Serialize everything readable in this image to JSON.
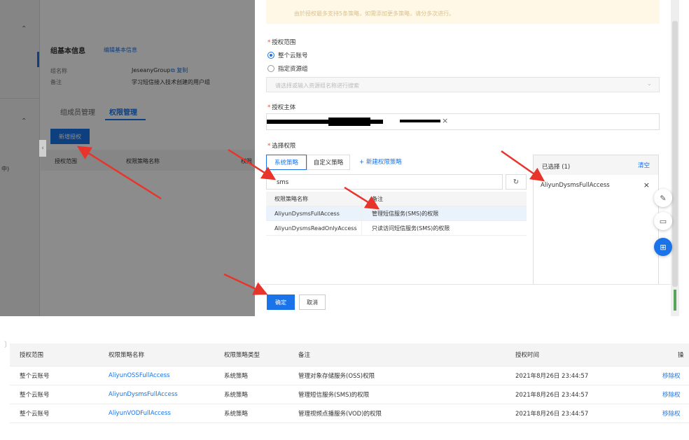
{
  "background": {
    "group_basic_info_title": "组基本信息",
    "edit_basic_info": "编辑基本信息",
    "group_name_label": "组名称",
    "group_name_value": "JeseanyGroup",
    "copy_label": "复制",
    "remark_label": "备注",
    "remark_value": "学习短信接入技术创建的用户组",
    "tabs": [
      "组成员管理",
      "权限管理"
    ],
    "add_grant_button": "新增授权",
    "col_scope": "授权范围",
    "col_policy_name": "权限策略名称",
    "col_partial": "权限",
    "side_partial_text": "中)"
  },
  "drawer": {
    "warning_text": "由於授权最多支持5条策略，如需添加更多策略，请分多次进行。",
    "scope_label": "授权范围",
    "scope_options": [
      {
        "label": "整个云账号",
        "checked": true
      },
      {
        "label": "指定资源组",
        "checked": false
      }
    ],
    "resource_group_placeholder": "请选择或输入资源组名称进行搜索",
    "principal_label": "授权主体",
    "select_permission_label": "选择权限",
    "policy_tabs": [
      "系统策略",
      "自定义策略"
    ],
    "new_policy_link": "+ 新建权限策略",
    "search_value": "sms",
    "policy_table": {
      "headers": [
        "权限策略名称",
        "备注"
      ],
      "rows": [
        {
          "name": "AliyunDysmsFullAccess",
          "remark": "管理短信服务(SMS)的权限"
        },
        {
          "name": "AliyunDysmsReadOnlyAccess",
          "remark": "只读访问短信服务(SMS)的权限"
        }
      ]
    },
    "selected_panel": {
      "title": "已选择 (1)",
      "clear": "清空",
      "items": [
        "AliyunDysmsFullAccess"
      ]
    },
    "ok_button": "确定",
    "cancel_button": "取消"
  },
  "result_table": {
    "headers": [
      "授权范围",
      "权限策略名称",
      "权限策略类型",
      "备注",
      "授权时间",
      "操"
    ],
    "rows": [
      {
        "scope": "整个云账号",
        "policy": "AliyunOSSFullAccess",
        "type": "系统策略",
        "remark": "管理对象存储服务(OSS)权限",
        "time": "2021年8月26日 23:44:57",
        "action": "移除权"
      },
      {
        "scope": "整个云账号",
        "policy": "AliyunDysmsFullAccess",
        "type": "系统策略",
        "remark": "管理短信服务(SMS)的权限",
        "time": "2021年8月26日 23:44:57",
        "action": "移除权"
      },
      {
        "scope": "整个云账号",
        "policy": "AliyunVODFullAccess",
        "type": "系统策略",
        "remark": "管理视频点播服务(VOD)的权限",
        "time": "2021年8月26日 23:44:57",
        "action": "移除权"
      }
    ]
  },
  "colors": {
    "accent": "#1a73e8",
    "annotation_red": "#e8352c"
  }
}
